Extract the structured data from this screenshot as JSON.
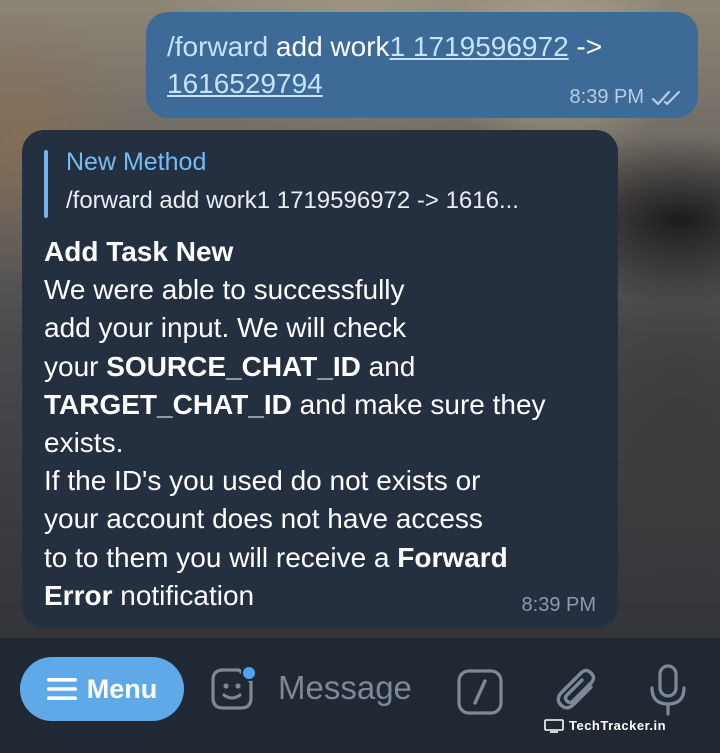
{
  "outgoing_message": {
    "command": "/forward",
    "text_part1": " add work",
    "link_1": "1 1719596972",
    "arrow": " ->",
    "link_2": "1616529794",
    "time": "8:39 PM",
    "status_icon": "double-check-icon"
  },
  "incoming_message": {
    "reply": {
      "author": "New Method",
      "preview": "/forward add work1 1719596972 -> 1616..."
    },
    "title": "Add Task New",
    "line1": "We were able to successfully",
    "line2": "add your input. We will check",
    "line3_pre": "your ",
    "source_id": "SOURCE_CHAT_ID",
    "line3_post": " and",
    "target_id": "TARGET_CHAT_ID",
    "line4_post": " and make sure they",
    "line5": "exists.",
    "line6": "If the ID's you used do not exists or",
    "line7": "your account does not have access",
    "line8_pre": "to to them you will receive a ",
    "forward_error_1": "Forward",
    "forward_error_2": "Error",
    "line9_post": " notification",
    "time": "8:39 PM"
  },
  "input_bar": {
    "menu_label": "Menu",
    "placeholder": "Message",
    "icons": [
      "sticker-icon",
      "slash-command-icon",
      "attach-icon",
      "microphone-icon"
    ]
  },
  "watermark": {
    "text": "TechTracker.in"
  },
  "colors": {
    "outgoing_bubble": "#3d6a97",
    "incoming_bubble": "#243040",
    "accent": "#5fa9e8",
    "reply_author": "#72bdf5",
    "input_bar": "#1f2833"
  }
}
